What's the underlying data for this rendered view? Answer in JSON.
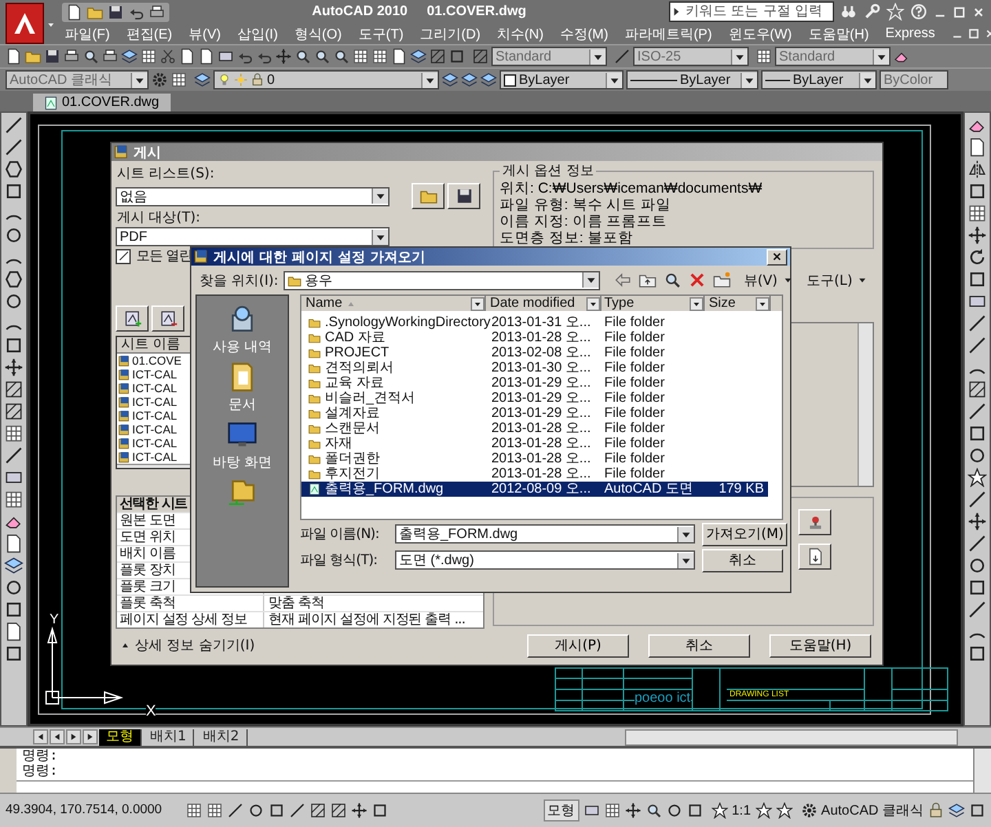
{
  "window": {
    "title": "AutoCAD 2010",
    "document": "01.COVER.dwg"
  },
  "search": {
    "placeholder": "키워드 또는 구절 입력"
  },
  "menu": [
    "파일(F)",
    "편집(E)",
    "뷰(V)",
    "삽입(I)",
    "형식(O)",
    "도구(T)",
    "그리기(D)",
    "치수(N)",
    "수정(M)",
    "파라메트릭(P)",
    "윈도우(W)",
    "도움말(H)",
    "Express"
  ],
  "styles_toolbar": {
    "text_style": "Standard",
    "dimension_style": "ISO-25",
    "table_style": "Standard"
  },
  "layers_toolbar": {
    "workspace": "AutoCAD 클래식",
    "layer": "0",
    "color_control": "ByLayer",
    "linetype": "ByLayer",
    "lineweight": "ByLayer",
    "plot_style": "ByColor"
  },
  "document_tabs": [
    {
      "label": "01.COVER.dwg",
      "selected": true
    }
  ],
  "drawing": {
    "y_axis": "Y",
    "x_axis": "X",
    "title_block_title": "DRAWING LIST",
    "title_block_logo": "poeoo ict"
  },
  "layout_tabs": [
    {
      "label": "모형",
      "selected": true
    },
    {
      "label": "배치1",
      "selected": false
    },
    {
      "label": "배치2",
      "selected": false
    }
  ],
  "command_lines": [
    "명령:",
    "명령:"
  ],
  "status_bar": {
    "coordinates": "49.3904, 170.7514, 0.0000",
    "model_button": "모형",
    "annotation_scale": "1:1",
    "workspace": "AutoCAD 클래식"
  },
  "publish_dialog": {
    "title": "게시",
    "sheet_list_label": "시트 리스트(S):",
    "sheet_list": "없음",
    "publish_to_label": "게시 대상(T):",
    "publish_to": "PDF",
    "open_drawings": {
      "label": "모든 열린",
      "checked": true
    },
    "sheet_column": "시트 이름",
    "sheets": [
      "01.COVE",
      "ICT-CAL",
      "ICT-CAL",
      "ICT-CAL",
      "ICT-CAL",
      "ICT-CAL",
      "ICT-CAL",
      "ICT-CAL"
    ],
    "details_header": "선택한 시트",
    "details": [
      {
        "label": "원본 도면"
      },
      {
        "label": "도면 위치"
      },
      {
        "label": "배치 이름"
      },
      {
        "label": "플롯 장치"
      },
      {
        "label": "플롯 크기"
      },
      {
        "label": "플롯 축척",
        "value": "맞춤 축척"
      },
      {
        "label": "페이지 설정 상세 정보",
        "value": "현재 페이지 설정에 지정된 출력 ..."
      }
    ],
    "options_title": "게시 옵션 정보",
    "options": [
      "위치: C:₩Users₩iceman₩documents₩",
      "파일 유형: 복수 시트 파일",
      "이름 지정: 이름 프롬프트",
      "도면층 정보: 불포함"
    ],
    "details_toggle": "상세 정보 숨기기(I)",
    "buttons": [
      "게시(P)",
      "취소",
      "도움말(H)"
    ]
  },
  "import_dialog": {
    "title": "게시에 대한 페이지 설정 가져오기",
    "look_in_label": "찾을 위치(I):",
    "look_in": "용우",
    "view_menu": "뷰(V)",
    "tools_menu": "도구(L)",
    "places": [
      {
        "label": "사용 내역",
        "kind": "history"
      },
      {
        "label": "문서",
        "kind": "documents"
      },
      {
        "label": "바탕 화면",
        "kind": "desktop"
      },
      {
        "kind": "network"
      }
    ],
    "columns": [
      "Name",
      "Date modified",
      "Type",
      "Size"
    ],
    "files": [
      {
        "name": ".SynologyWorkingDirectory",
        "date": "2013-01-31 오...",
        "type": "File folder",
        "kind": "folder",
        "selected": false
      },
      {
        "name": "CAD 자료",
        "date": "2013-01-28 오...",
        "type": "File folder",
        "kind": "folder",
        "selected": false
      },
      {
        "name": "PROJECT",
        "date": "2013-02-08 오...",
        "type": "File folder",
        "kind": "folder",
        "selected": false
      },
      {
        "name": "견적의뢰서",
        "date": "2013-01-30 오...",
        "type": "File folder",
        "kind": "folder",
        "selected": false
      },
      {
        "name": "교육 자료",
        "date": "2013-01-29 오...",
        "type": "File folder",
        "kind": "folder",
        "selected": false
      },
      {
        "name": "비슬러_견적서",
        "date": "2013-01-29 오...",
        "type": "File folder",
        "kind": "folder",
        "selected": false
      },
      {
        "name": "설계자료",
        "date": "2013-01-29 오...",
        "type": "File folder",
        "kind": "folder",
        "selected": false
      },
      {
        "name": "스캔문서",
        "date": "2013-01-28 오...",
        "type": "File folder",
        "kind": "folder",
        "selected": false
      },
      {
        "name": "자재",
        "date": "2013-01-28 오...",
        "type": "File folder",
        "kind": "folder",
        "selected": false
      },
      {
        "name": "폴더권한",
        "date": "2013-01-28 오...",
        "type": "File folder",
        "kind": "folder",
        "selected": false
      },
      {
        "name": "후지전기",
        "date": "2013-01-28 오...",
        "type": "File folder",
        "kind": "folder",
        "selected": false
      },
      {
        "name": "출력용_FORM.dwg",
        "date": "2012-08-09 오...",
        "type": "AutoCAD 도면",
        "size": "179 KB",
        "kind": "drawing",
        "selected": true
      }
    ],
    "file_name_label": "파일 이름(N):",
    "file_name": "출력용_FORM.dwg",
    "file_type_label": "파일 형식(T):",
    "file_type": "도면 (*.dwg)",
    "buttons": [
      "가져오기(M)",
      "취소"
    ]
  }
}
